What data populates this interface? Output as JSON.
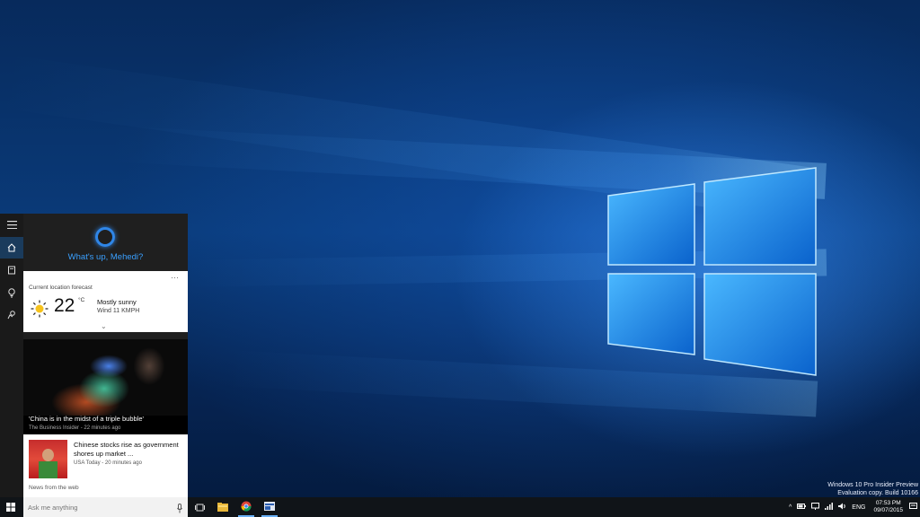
{
  "cortana": {
    "greeting": "What's up, Mehedi?",
    "rail": [
      {
        "name": "hamburger-menu-icon"
      },
      {
        "name": "home-icon",
        "active": true
      },
      {
        "name": "notebook-icon"
      },
      {
        "name": "lightbulb-icon"
      },
      {
        "name": "feedback-icon"
      }
    ],
    "weather": {
      "label": "Current location forecast",
      "more": "···",
      "icon": "sun-icon",
      "temperature": "22",
      "unit": "°C",
      "condition": "Mostly sunny",
      "wind": "Wind 11 KMPH",
      "expand": "⌄"
    },
    "news": [
      {
        "title": "'China is in the midst of a triple bubble'",
        "source": "The Business Insider - 22 minutes ago"
      },
      {
        "title": "Chinese stocks rise as government shores up market ...",
        "source": "USA Today - 20 minutes ago"
      }
    ],
    "web_label": "News from the web",
    "search_placeholder": "Ask me anything"
  },
  "watermark": {
    "line1": "Windows 10 Pro Insider Preview",
    "line2": "Evaluation copy. Build 10166"
  },
  "taskbar": {
    "apps": [
      "task-view-icon",
      "file-explorer-icon",
      "chrome-icon",
      "app-icon"
    ],
    "tray": {
      "chevron": "^",
      "language": "ENG",
      "time": "07:53 PM",
      "date": "09/07/2015"
    }
  },
  "colors": {
    "accent": "#3aa0ff",
    "taskbar": "#101418"
  }
}
